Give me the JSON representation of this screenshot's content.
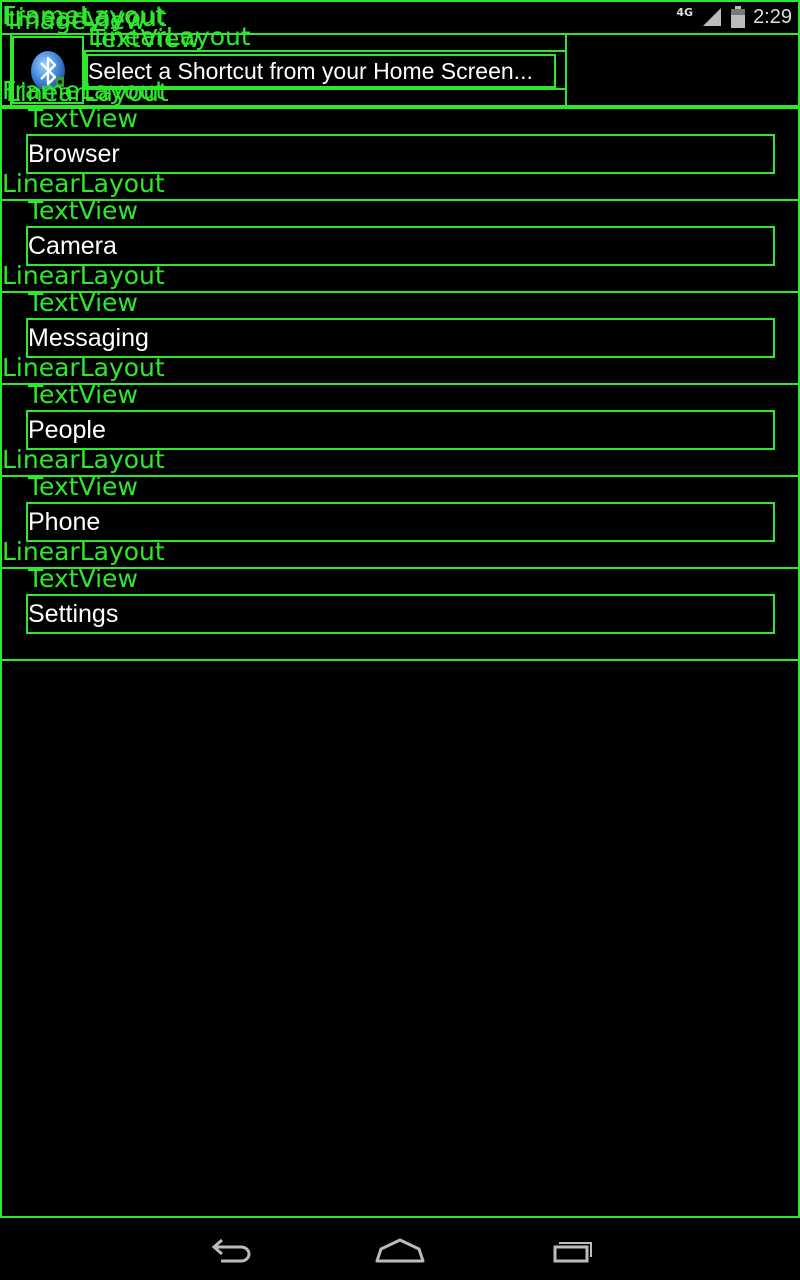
{
  "status_bar": {
    "network_type": "4G",
    "time": "2:29"
  },
  "header": {
    "title": "Select a Shortcut from your Home Screen..."
  },
  "list": {
    "items": [
      {
        "label": "Browser"
      },
      {
        "label": "Camera"
      },
      {
        "label": "Messaging"
      },
      {
        "label": "People"
      },
      {
        "label": "Phone"
      },
      {
        "label": "Settings"
      }
    ]
  },
  "overlay_labels": {
    "frame_layout": "FrameLayout",
    "linear_layout": "LinearLayout",
    "image_view": "ImageView",
    "text_view": "TextView",
    "frame_layout_lower": "FrameLayout"
  },
  "icons": {
    "app_icon": "bluetooth-shortcut-icon",
    "back": "back-icon",
    "home": "home-icon",
    "recents": "recents-icon"
  },
  "colors": {
    "overlay": "#2ee82e",
    "background": "#000000",
    "text": "#ffffff"
  }
}
